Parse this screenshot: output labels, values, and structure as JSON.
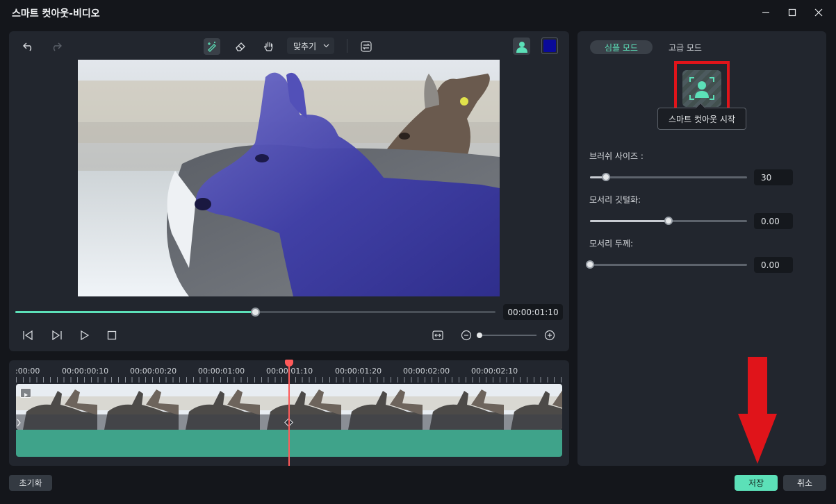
{
  "window": {
    "title": "스마트 컷아웃-비디오"
  },
  "toolbar": {
    "fit_label": "맞추기",
    "overlay_color": "#0a0a9a",
    "accent": "#5ce0b8"
  },
  "player": {
    "timecode": "00:00:01:10",
    "progress": 0.5
  },
  "timeline": {
    "ruler_labels": [
      ":00:00",
      "00:00:00:10",
      "00:00:00:20",
      "00:00:01:00",
      "00:00:01:10",
      "00:00:01:20",
      "00:00:02:00",
      "00:00:02:10"
    ],
    "playhead_color": "#ff5a5a",
    "track_color": "#3fa38a"
  },
  "panel": {
    "tabs": {
      "simple": "심플 모드",
      "advanced": "고급 모드"
    },
    "start_tooltip": "스마트 컷아웃 시작",
    "brush": {
      "label": "브러쉬 사이즈 :",
      "value": "30",
      "level": 0.1
    },
    "feather": {
      "label": "모서리 깃털화:",
      "value": "0.00",
      "level": 0.5
    },
    "thickness": {
      "label": "모서리 두께:",
      "value": "0.00",
      "level": 0.0
    }
  },
  "footer": {
    "reset_label": "초기화",
    "save_label": "저장",
    "cancel_label": "취소"
  },
  "annotations": {
    "highlight_color": "#e0141a"
  }
}
